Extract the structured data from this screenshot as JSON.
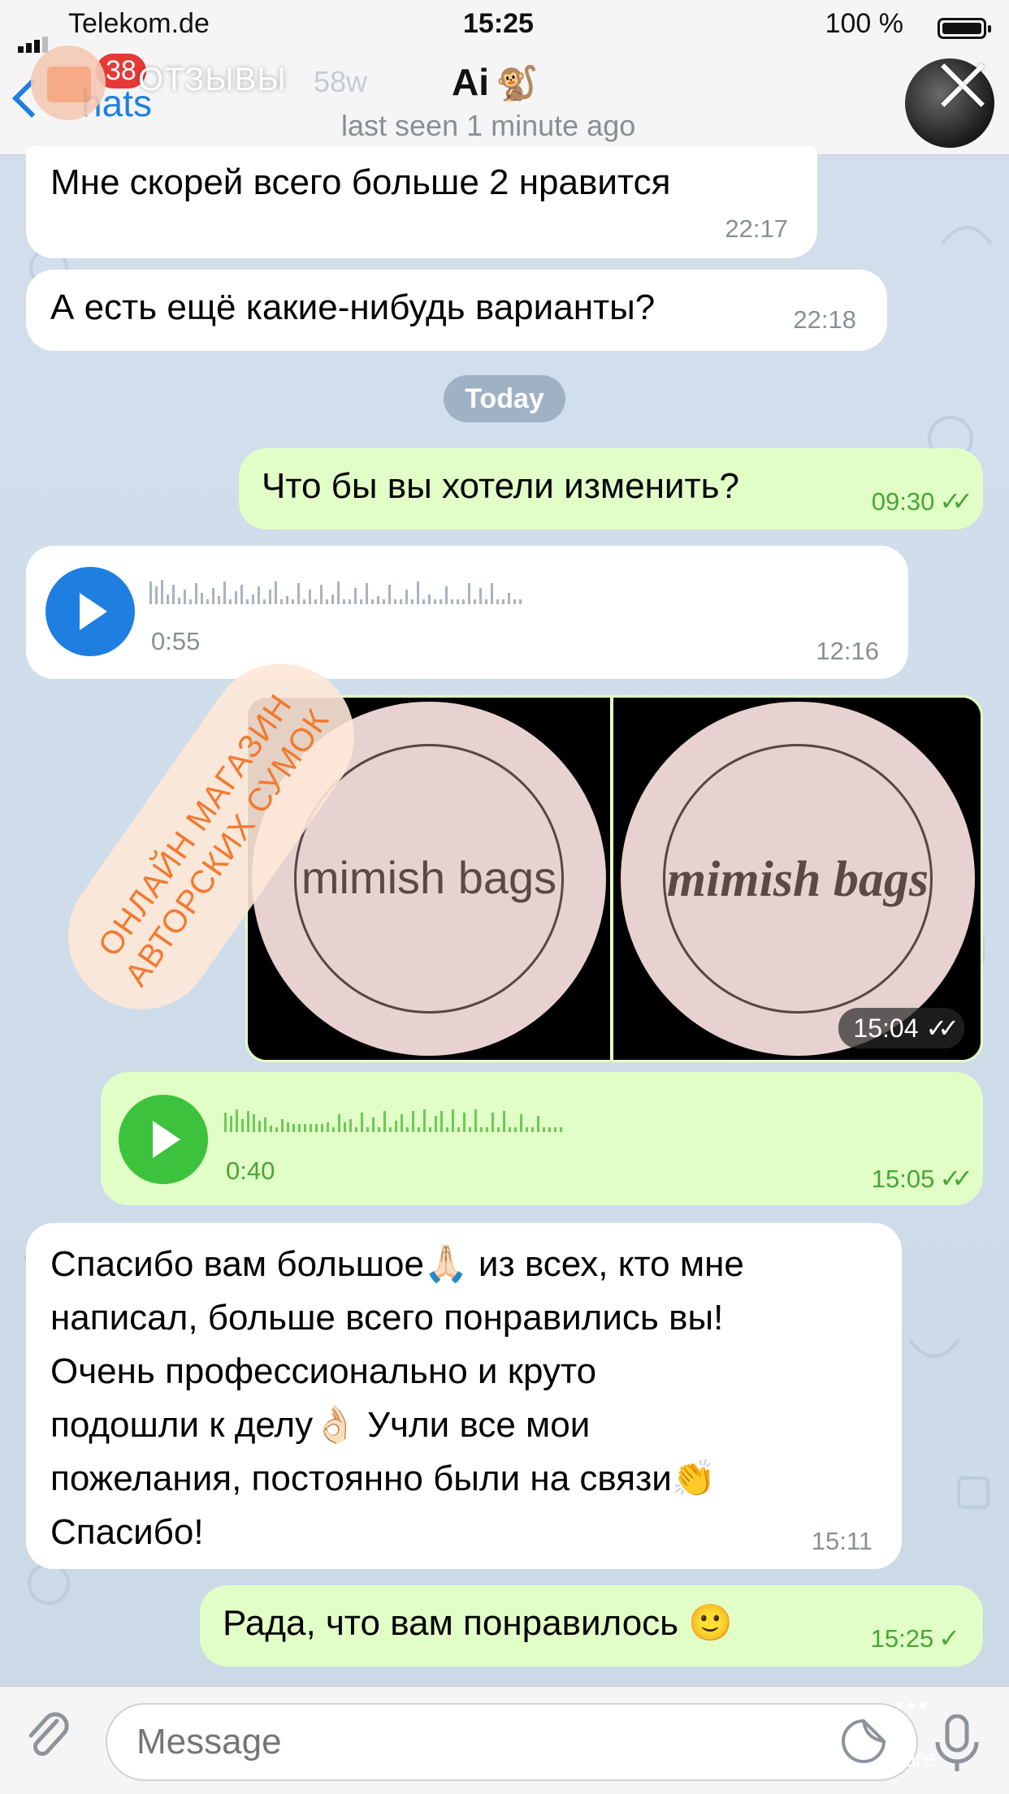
{
  "status_bar": {
    "carrier": "Telekom.de",
    "time": "15:25",
    "battery": "100 %"
  },
  "header": {
    "back_label": "hats",
    "unread_count": "38",
    "story_title": "ОТЗЫВЫ",
    "story_age": "58w",
    "chat_name": "Ai",
    "chat_name_emoji": "🐒",
    "chat_status": "last seen 1 minute ago"
  },
  "messages": {
    "m1": {
      "text": "Мне скорей всего больше 2 нравится",
      "time": "22:17"
    },
    "m2": {
      "text": "А есть ещё какие-нибудь варианты?",
      "time": "22:18"
    },
    "date_sep": "Today",
    "m3": {
      "text": "Что бы вы хотели изменить?",
      "time": "09:30"
    },
    "m4": {
      "duration": "0:55",
      "time": "12:16"
    },
    "m5": {
      "brand_left": "mimish bags",
      "brand_right": "mimish bags",
      "time": "15:04"
    },
    "m6": {
      "duration": "0:40",
      "time": "15:05"
    },
    "m7": {
      "line1": "Спасибо вам большое🙏🏻 из всех, кто мне",
      "line2": "написал, больше всего понравились вы!",
      "line3": "Очень профессионально и круто",
      "line4": "подошли к делу👌🏻 Учли все мои",
      "line5": "пожелания, постоянно были на связи👏",
      "line6": "Спасибо!",
      "time": "15:11"
    },
    "m8": {
      "text": "Рада, что вам понравилось 🙂",
      "time": "15:25"
    }
  },
  "promo": {
    "line1": "ОНЛАЙН МАГАЗИН",
    "line2": "АВТОРСКИХ СУМОК"
  },
  "input": {
    "placeholder": "Message"
  },
  "overlay": {
    "more": "More",
    "dots": "•••"
  },
  "colors": {
    "accent": "#1f7fe0",
    "outgoing": "#e1fec6",
    "incoming": "#ffffff",
    "play_blue": "#1f7fe0",
    "play_green": "#3cc23c",
    "promo_orange": "#f27a2f"
  },
  "icons": [
    "back-chevron-icon",
    "close-icon",
    "play-icon",
    "attach-icon",
    "sticker-icon",
    "mic-icon",
    "double-check-icon",
    "single-check-icon"
  ]
}
